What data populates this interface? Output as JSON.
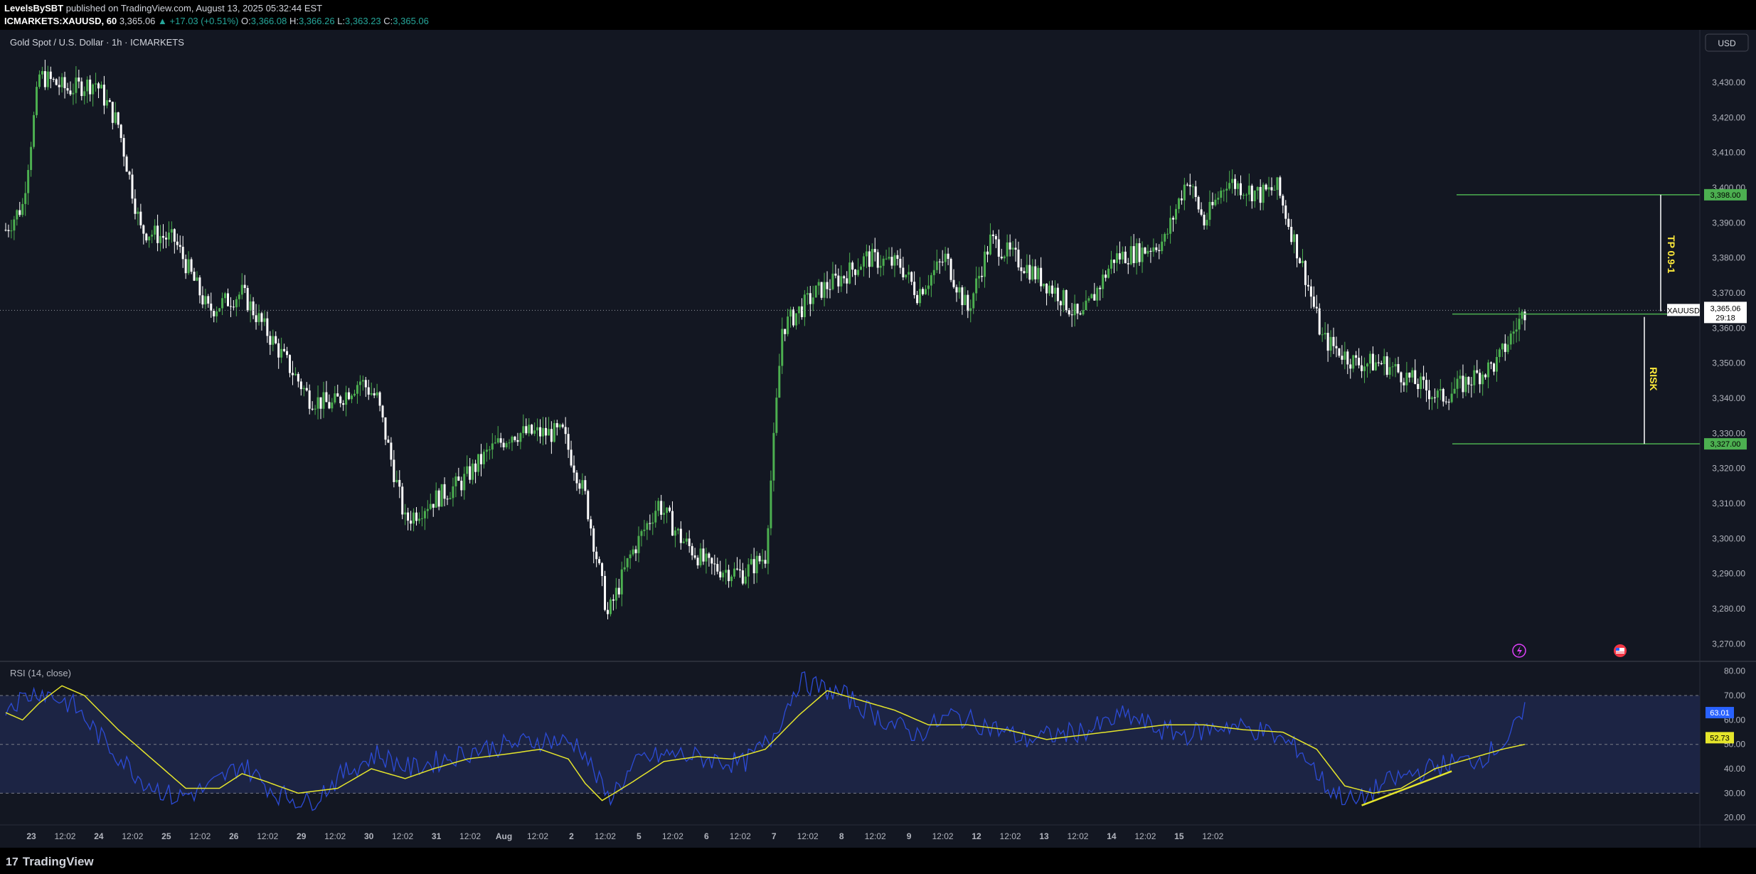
{
  "header": {
    "author": "LevelsBySBT",
    "published_text": "published on TradingView.com, August 13, 2025 05:32:44 EST",
    "symbol": "ICMARKETS:XAUUSD, 60",
    "last": "3,365.06",
    "change": "▲ +17.03 (+0.51%)",
    "o_label": "O:",
    "o_value": "3,366.08",
    "h_label": "H:",
    "h_value": "3,366.26",
    "l_label": "L:",
    "l_value": "3,363.23",
    "c_label": "C:",
    "c_value": "3,365.06"
  },
  "pane": {
    "title": "Gold Spot / U.S. Dollar · 1h · ICMARKETS",
    "currency_button": "USD",
    "symbol_tag": "XAUUSD",
    "price_tag": "3,365.06",
    "countdown": "29:18"
  },
  "footer": {
    "logo_text": "TradingView"
  },
  "colors": {
    "background": "#131722",
    "up": "#4caf50",
    "down": "#ffffff",
    "rsi_line": "#2c4bd6",
    "rsi_ma": "#e5e52b",
    "levels": "#4caf50",
    "annotation_text": "#ffeb3b"
  },
  "chart_data": [
    {
      "type": "candlestick",
      "title": "Gold Spot / U.S. Dollar · 1h · ICMARKETS",
      "ylim": [
        3265,
        3445
      ],
      "y_ticks": [
        "3,270.00",
        "3,280.00",
        "3,290.00",
        "3,300.00",
        "3,310.00",
        "3,320.00",
        "3,330.00",
        "3,340.00",
        "3,350.00",
        "3,360.00",
        "3,370.00",
        "3,380.00",
        "3,390.00",
        "3,400.00",
        "3,410.00",
        "3,420.00",
        "3,430.00"
      ],
      "y_tick_values": [
        3270,
        3280,
        3290,
        3300,
        3310,
        3320,
        3330,
        3340,
        3350,
        3360,
        3370,
        3380,
        3390,
        3400,
        3410,
        3420,
        3430
      ],
      "x_tick_labels": [
        "23",
        "12:02",
        "24",
        "12:02",
        "25",
        "12:02",
        "26",
        "12:02",
        "29",
        "12:02",
        "30",
        "12:02",
        "31",
        "12:02",
        "Aug",
        "12:02",
        "2",
        "12:02",
        "5",
        "12:02",
        "6",
        "12:02",
        "7",
        "12:02",
        "8",
        "12:02",
        "9",
        "12:02",
        "12",
        "12:02",
        "13",
        "12:02",
        "14",
        "12:02",
        "15",
        "12:02"
      ],
      "bars_per_tick": 12,
      "price_path": [
        [
          0,
          3388
        ],
        [
          6,
          3395
        ],
        [
          12,
          3432
        ],
        [
          22,
          3428
        ],
        [
          32,
          3430
        ],
        [
          40,
          3418
        ],
        [
          48,
          3388
        ],
        [
          60,
          3385
        ],
        [
          72,
          3365
        ],
        [
          84,
          3370
        ],
        [
          96,
          3355
        ],
        [
          108,
          3340
        ],
        [
          116,
          3338
        ],
        [
          126,
          3345
        ],
        [
          132,
          3340
        ],
        [
          142,
          3305
        ],
        [
          150,
          3310
        ],
        [
          162,
          3316
        ],
        [
          172,
          3325
        ],
        [
          180,
          3330
        ],
        [
          190,
          3330
        ],
        [
          198,
          3330
        ],
        [
          206,
          3312
        ],
        [
          214,
          3278
        ],
        [
          222,
          3295
        ],
        [
          232,
          3310
        ],
        [
          240,
          3300
        ],
        [
          250,
          3292
        ],
        [
          262,
          3290
        ],
        [
          270,
          3295
        ],
        [
          276,
          3360
        ],
        [
          288,
          3370
        ],
        [
          298,
          3375
        ],
        [
          306,
          3380
        ],
        [
          318,
          3378
        ],
        [
          324,
          3370
        ],
        [
          334,
          3380
        ],
        [
          342,
          3365
        ],
        [
          350,
          3385
        ],
        [
          362,
          3378
        ],
        [
          374,
          3370
        ],
        [
          382,
          3362
        ],
        [
          394,
          3380
        ],
        [
          404,
          3382
        ],
        [
          412,
          3385
        ],
        [
          420,
          3403
        ],
        [
          426,
          3390
        ],
        [
          434,
          3402
        ],
        [
          446,
          3398
        ],
        [
          452,
          3400
        ],
        [
          462,
          3375
        ],
        [
          468,
          3357
        ],
        [
          480,
          3350
        ],
        [
          490,
          3350
        ],
        [
          500,
          3345
        ],
        [
          510,
          3340
        ],
        [
          520,
          3345
        ],
        [
          530,
          3350
        ],
        [
          540,
          3365
        ]
      ],
      "last_price": 3365.06,
      "levels": [
        {
          "label": "3,398.00",
          "value": 3398
        },
        {
          "label": "3,364.00",
          "value": 3364
        },
        {
          "label": "3,327.00",
          "value": 3327
        }
      ],
      "annotations": [
        {
          "text": "TP 0.9-1"
        },
        {
          "text": "RISK"
        }
      ]
    },
    {
      "type": "line",
      "title": "RSI (14, close)",
      "ylim": [
        17,
        84
      ],
      "y_ticks": [
        "20.00",
        "30.00",
        "40.00",
        "50.00",
        "60.00",
        "70.00",
        "80.00"
      ],
      "y_tick_values": [
        20,
        30,
        40,
        50,
        60,
        70,
        80
      ],
      "band": [
        30,
        70
      ],
      "midline": 50,
      "series": [
        {
          "values_path": [
            [
              0,
              66
            ],
            [
              12,
              72
            ],
            [
              24,
              66
            ],
            [
              36,
              50
            ],
            [
              48,
              36
            ],
            [
              60,
              28
            ],
            [
              72,
              32
            ],
            [
              84,
              42
            ],
            [
              96,
              30
            ],
            [
              108,
              26
            ],
            [
              120,
              38
            ],
            [
              132,
              46
            ],
            [
              144,
              40
            ],
            [
              156,
              44
            ],
            [
              168,
              48
            ],
            [
              180,
              50
            ],
            [
              192,
              52
            ],
            [
              204,
              50
            ],
            [
              214,
              28
            ],
            [
              226,
              44
            ],
            [
              238,
              46
            ],
            [
              250,
              44
            ],
            [
              262,
              42
            ],
            [
              272,
              52
            ],
            [
              282,
              76
            ],
            [
              298,
              70
            ],
            [
              312,
              60
            ],
            [
              324,
              54
            ],
            [
              336,
              62
            ],
            [
              348,
              58
            ],
            [
              362,
              52
            ],
            [
              374,
              54
            ],
            [
              386,
              56
            ],
            [
              398,
              62
            ],
            [
              410,
              56
            ],
            [
              420,
              54
            ],
            [
              434,
              58
            ],
            [
              448,
              55
            ],
            [
              460,
              48
            ],
            [
              470,
              32
            ],
            [
              480,
              26
            ],
            [
              490,
              34
            ],
            [
              500,
              38
            ],
            [
              512,
              42
            ],
            [
              524,
              44
            ],
            [
              534,
              52
            ],
            [
              540,
              63
            ]
          ]
        },
        {
          "values_path": [
            [
              0,
              63
            ],
            [
              6,
              60
            ],
            [
              12,
              67
            ],
            [
              20,
              74
            ],
            [
              28,
              70
            ],
            [
              40,
              56
            ],
            [
              52,
              44
            ],
            [
              64,
              32
            ],
            [
              76,
              32
            ],
            [
              84,
              38
            ],
            [
              92,
              35
            ],
            [
              104,
              30
            ],
            [
              118,
              32
            ],
            [
              130,
              40
            ],
            [
              142,
              36
            ],
            [
              152,
              40
            ],
            [
              164,
              44
            ],
            [
              178,
              46
            ],
            [
              190,
              48
            ],
            [
              200,
              44
            ],
            [
              206,
              34
            ],
            [
              212,
              27
            ],
            [
              222,
              34
            ],
            [
              234,
              43
            ],
            [
              246,
              45
            ],
            [
              258,
              44
            ],
            [
              270,
              48
            ],
            [
              282,
              62
            ],
            [
              292,
              72
            ],
            [
              304,
              68
            ],
            [
              316,
              64
            ],
            [
              328,
              58
            ],
            [
              342,
              58
            ],
            [
              356,
              56
            ],
            [
              370,
              52
            ],
            [
              384,
              54
            ],
            [
              398,
              56
            ],
            [
              412,
              58
            ],
            [
              426,
              58
            ],
            [
              440,
              56
            ],
            [
              454,
              55
            ],
            [
              466,
              48
            ],
            [
              476,
              33
            ],
            [
              486,
              30
            ],
            [
              496,
              32
            ],
            [
              508,
              40
            ],
            [
              520,
              44
            ],
            [
              532,
              48
            ],
            [
              540,
              50
            ]
          ]
        }
      ],
      "rsi_value_label": "63.01",
      "ma_value_label": "52.73"
    }
  ]
}
